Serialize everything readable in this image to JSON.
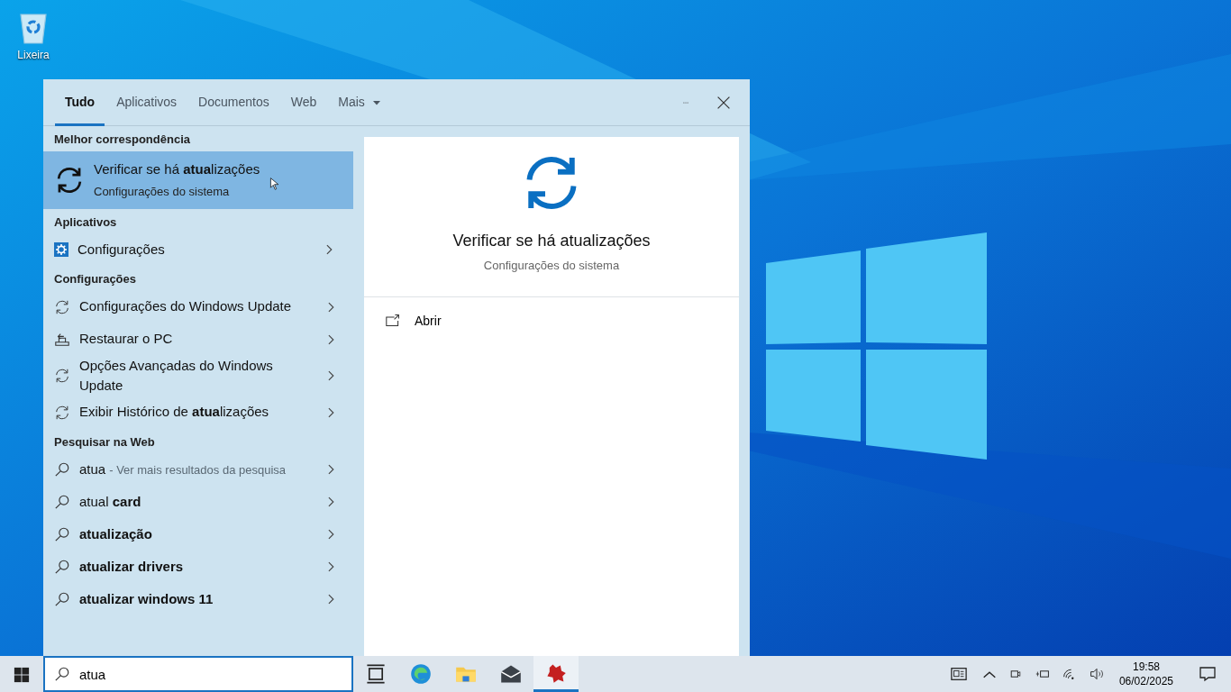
{
  "desktop_icons": [
    {
      "label": "Lixeira"
    }
  ],
  "search_panel": {
    "tabs": [
      {
        "label": "Tudo",
        "selected": true,
        "dropdown": false
      },
      {
        "label": "Aplicativos",
        "selected": false,
        "dropdown": false
      },
      {
        "label": "Documentos",
        "selected": false,
        "dropdown": false
      },
      {
        "label": "Web",
        "selected": false,
        "dropdown": false
      },
      {
        "label": "Mais",
        "selected": false,
        "dropdown": true
      }
    ],
    "sections": [
      {
        "heading": "Melhor correspondência",
        "items": [
          {
            "kind": "best",
            "title": "Verificar se há **atua**lizações",
            "subtitle": "Configurações do sistema",
            "selected": true
          }
        ]
      },
      {
        "heading": "Aplicativos",
        "items": [
          {
            "kind": "gear",
            "title": "Configurações",
            "selected": false
          }
        ]
      },
      {
        "heading": "Configurações",
        "items": [
          {
            "kind": "sync",
            "title": "Configurações do Windows Update",
            "selected": false
          },
          {
            "kind": "restore",
            "title": "Restaurar o PC",
            "selected": false
          },
          {
            "kind": "sync",
            "title": "Opções Avançadas do Windows Update",
            "selected": false
          },
          {
            "kind": "sync",
            "title": "Exibir Histórico de **atua**lizações",
            "selected": false
          }
        ]
      },
      {
        "heading": "Pesquisar na Web",
        "items": [
          {
            "kind": "search",
            "title": "atua",
            "hint": "- Ver mais resultados da pesquisa",
            "selected": false
          },
          {
            "kind": "search",
            "title": "atual **card**",
            "selected": false
          },
          {
            "kind": "search",
            "title": "**atualização**",
            "selected": false
          },
          {
            "kind": "search",
            "title": "**atualizar drivers**",
            "selected": false
          },
          {
            "kind": "search",
            "title": "**atualizar windows 11**",
            "selected": false
          }
        ]
      }
    ],
    "preview": {
      "title": "Verificar se há atualizações",
      "subtitle": "Configurações do sistema",
      "actions": [
        {
          "label": "Abrir"
        }
      ]
    }
  },
  "taskbar": {
    "search": {
      "value": "atua"
    },
    "apps": [
      {
        "kind": "task-view",
        "active": false
      },
      {
        "kind": "browser",
        "active": false
      },
      {
        "kind": "folder",
        "active": false
      },
      {
        "kind": "mail",
        "active": false
      },
      {
        "kind": "app",
        "active": true
      }
    ],
    "clock": {
      "time": "19:58",
      "date": "06/02/2025"
    }
  }
}
